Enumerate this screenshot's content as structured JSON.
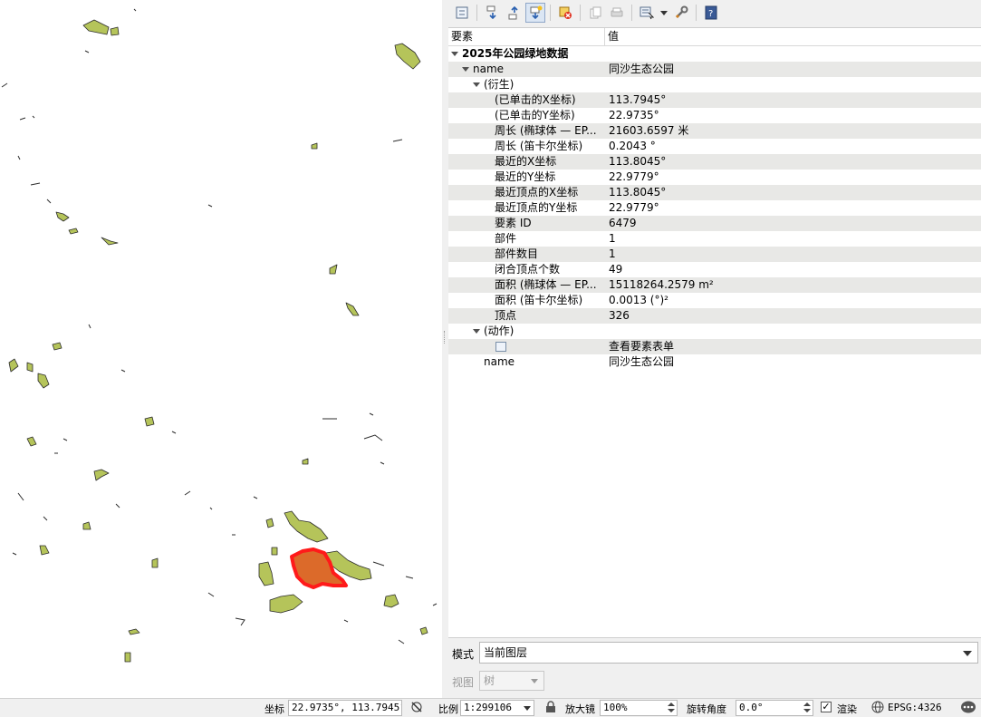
{
  "toolbar": {
    "icons": [
      "expand-tree-icon",
      "expand-all-icon",
      "collapse-all-icon",
      "expand-new-icon",
      "clear-results-icon",
      "copy-feature-icon",
      "print-icon",
      "select-mode-icon",
      "dropdown-icon",
      "settings-icon",
      "help-icon"
    ]
  },
  "tree": {
    "header": {
      "feature": "要素",
      "value": "值"
    },
    "layer": "2025年公园绿地数据",
    "name_key": "name",
    "name_value": "同沙生态公园",
    "derived_label": "(衍生)",
    "derived": [
      {
        "k": "(已单击的X坐标)",
        "v": "113.7945°"
      },
      {
        "k": "(已单击的Y坐标)",
        "v": "22.9735°"
      },
      {
        "k": "周长 (椭球体 — EP...",
        "v": "21603.6597 米"
      },
      {
        "k": "周长 (笛卡尔坐标)",
        "v": "0.2043 °"
      },
      {
        "k": "最近的X坐标",
        "v": "113.8045°"
      },
      {
        "k": "最近的Y坐标",
        "v": "22.9779°"
      },
      {
        "k": "最近顶点的X坐标",
        "v": "113.8045°"
      },
      {
        "k": "最近顶点的Y坐标",
        "v": "22.9779°"
      },
      {
        "k": "要素 ID",
        "v": "6479"
      },
      {
        "k": "部件",
        "v": "1"
      },
      {
        "k": "部件数目",
        "v": "1"
      },
      {
        "k": "闭合顶点个数",
        "v": "49"
      },
      {
        "k": "面积 (椭球体 — EP...",
        "v": "15118264.2579 m²"
      },
      {
        "k": "面积 (笛卡尔坐标)",
        "v": "0.0013 (°)²"
      },
      {
        "k": "顶点",
        "v": "326"
      }
    ],
    "actions_label": "(动作)",
    "action_value": "查看要素表单",
    "attr_key": "name",
    "attr_value": "同沙生态公园"
  },
  "mode": {
    "label": "模式",
    "value": "当前图层"
  },
  "view": {
    "label": "视图",
    "value": "树"
  },
  "status": {
    "coord_label": "坐标",
    "coord_value": "22.9735°, 113.7945°",
    "scale_label": "比例",
    "scale_value": "1:299106",
    "magnifier_label": "放大镜",
    "magnifier_value": "100%",
    "rotation_label": "旋转角度",
    "rotation_value": "0.0°",
    "render_label": "渲染",
    "crs": "EPSG:4326"
  },
  "colors": {
    "polygon_fill": "#b5c45a",
    "highlight_stroke": "#ff1a1a",
    "highlight_fill": "#dc6a2a"
  }
}
